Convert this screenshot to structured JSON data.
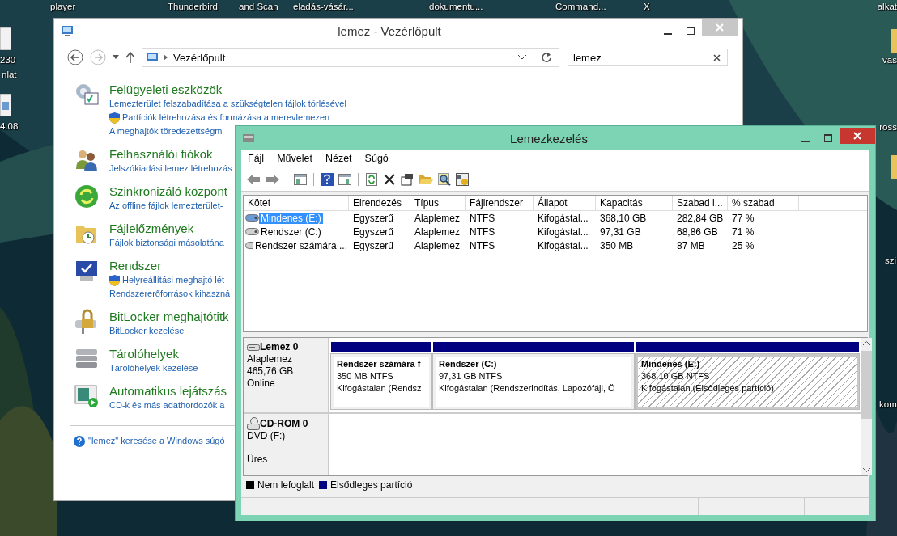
{
  "desktop": {
    "labels": [
      "player",
      "Thunderbird",
      "and Scan",
      "eladás-vásár...",
      "dokumentu...",
      "Command...",
      "X",
      "alkat",
      "230",
      "nlat",
      "4.08",
      "vas",
      "ross",
      "szi",
      "kom"
    ]
  },
  "control_panel": {
    "title": "lemez - Vezérlőpult",
    "address": "Vezérlőpult",
    "search": {
      "value": "lemez"
    },
    "items": [
      {
        "title": "Felügyeleti eszközök",
        "links": [
          {
            "text": "Lemezterület felszabadítása a szükségtelen fájlok törlésével",
            "shield": false
          },
          {
            "text": "Partíciók létrehozása és formázása a merevlemezen",
            "shield": true
          },
          {
            "text": "A meghajtók töredezettségm",
            "shield": false
          }
        ]
      },
      {
        "title": "Felhasználói fiókok",
        "links": [
          {
            "text": "Jelszókiadási lemez létrehozás",
            "shield": false
          }
        ]
      },
      {
        "title": "Szinkronizáló központ",
        "links": [
          {
            "text": "Az offline fájlok lemezterület-",
            "shield": false
          }
        ]
      },
      {
        "title": "Fájlelőzmények",
        "links": [
          {
            "text": "Fájlok biztonsági másolatána",
            "shield": false
          }
        ]
      },
      {
        "title": "Rendszer",
        "links": [
          {
            "text": "Helyreállítási meghajtó lét",
            "shield": true
          },
          {
            "text": "Rendszererőforrások kihaszná",
            "shield": false
          }
        ]
      },
      {
        "title": "BitLocker meghajtótitk",
        "links": [
          {
            "text": "BitLocker kezelése",
            "shield": false
          }
        ]
      },
      {
        "title": "Tárolóhelyek",
        "links": [
          {
            "text": "Tárolóhelyek kezelése",
            "shield": false
          }
        ]
      },
      {
        "title": "Automatikus lejátszás",
        "links": [
          {
            "text": "CD-k és más adathordozók a",
            "shield": false
          }
        ]
      }
    ],
    "help_link": "\"lemez\" keresése a Windows súgó"
  },
  "disk_management": {
    "title": "Lemezkezelés",
    "menu": [
      "Fájl",
      "Művelet",
      "Nézet",
      "Súgó"
    ],
    "table": {
      "columns": [
        "Kötet",
        "Elrendezés",
        "Típus",
        "Fájlrendszer",
        "Állapot",
        "Kapacitás",
        "Szabad l...",
        "% szabad"
      ],
      "rows": [
        {
          "selected": true,
          "cells": [
            "Mindenes (E:)",
            "Egyszerű",
            "Alaplemez",
            "NTFS",
            "Kifogástal...",
            "368,10 GB",
            "282,84 GB",
            "77 %"
          ]
        },
        {
          "selected": false,
          "cells": [
            "Rendszer (C:)",
            "Egyszerű",
            "Alaplemez",
            "NTFS",
            "Kifogástal...",
            "97,31 GB",
            "68,86 GB",
            "71 %"
          ]
        },
        {
          "selected": false,
          "cells": [
            "Rendszer számára ...",
            "Egyszerű",
            "Alaplemez",
            "NTFS",
            "Kifogástal...",
            "350 MB",
            "87 MB",
            "25 %"
          ]
        }
      ]
    },
    "disks": [
      {
        "kind": "disk",
        "name": "Lemez 0",
        "lines": [
          "Alaplemez",
          "465,76 GB",
          "Online"
        ],
        "partitions": [
          {
            "name": "Rendszer számára f",
            "size": "350 MB NTFS",
            "status": "Kifogástalan (Rendsz",
            "selected": false
          },
          {
            "name": "Rendszer  (C:)",
            "size": "97,31 GB NTFS",
            "status": "Kifogástalan (Rendszerindítás, Lapozófájl, Ö",
            "selected": false
          },
          {
            "name": "Mindenes  (E:)",
            "size": "368,10 GB NTFS",
            "status": "Kifogástalan (Elsődleges partíció)",
            "selected": true
          }
        ]
      },
      {
        "kind": "cdrom",
        "name": "CD-ROM 0",
        "lines": [
          "DVD (F:)",
          "Üres"
        ]
      }
    ],
    "legend": [
      {
        "label": "Nem lefoglalt",
        "color": "#000000"
      },
      {
        "label": "Elsődleges partíció",
        "color": "#000080"
      }
    ]
  }
}
